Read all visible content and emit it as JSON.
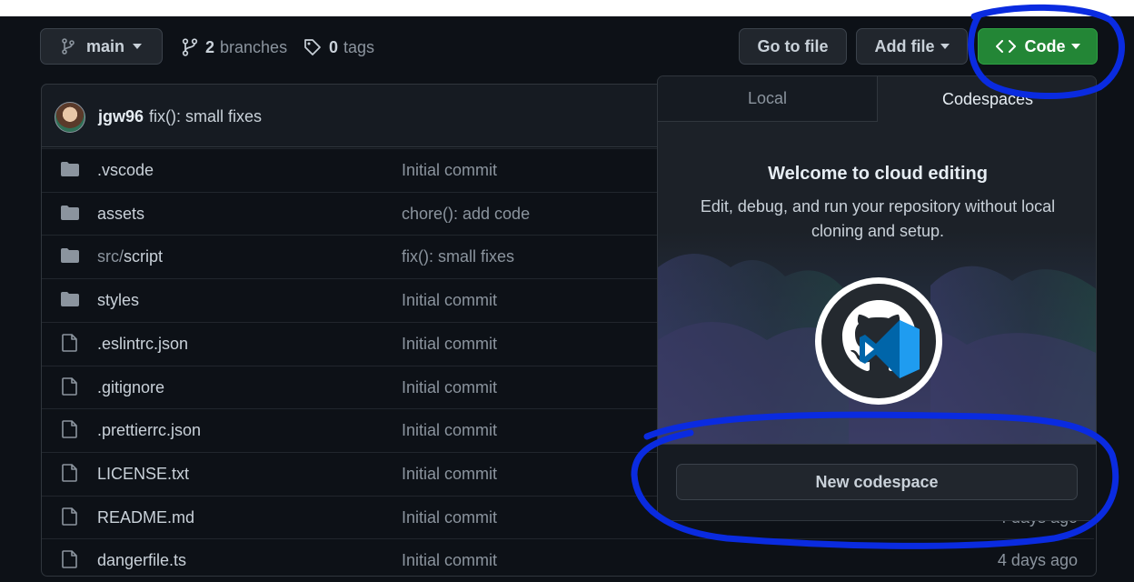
{
  "toolbar": {
    "branch_label": "main",
    "branches_count": "2",
    "branches_label": "branches",
    "tags_count": "0",
    "tags_label": "tags",
    "go_to_file": "Go to file",
    "add_file": "Add file",
    "code": "Code"
  },
  "commit": {
    "author": "jgw96",
    "message": "fix(): small fixes"
  },
  "files": [
    {
      "type": "folder",
      "prefix": "",
      "name": ".vscode",
      "message": "Initial commit",
      "age": ""
    },
    {
      "type": "folder",
      "prefix": "",
      "name": "assets",
      "message": "chore(): add code",
      "age": ""
    },
    {
      "type": "folder",
      "prefix": "src/",
      "name": "script",
      "message": "fix(): small fixes",
      "age": ""
    },
    {
      "type": "folder",
      "prefix": "",
      "name": "styles",
      "message": "Initial commit",
      "age": ""
    },
    {
      "type": "file",
      "prefix": "",
      "name": ".eslintrc.json",
      "message": "Initial commit",
      "age": ""
    },
    {
      "type": "file",
      "prefix": "",
      "name": ".gitignore",
      "message": "Initial commit",
      "age": ""
    },
    {
      "type": "file",
      "prefix": "",
      "name": ".prettierrc.json",
      "message": "Initial commit",
      "age": ""
    },
    {
      "type": "file",
      "prefix": "",
      "name": "LICENSE.txt",
      "message": "Initial commit",
      "age": ""
    },
    {
      "type": "file",
      "prefix": "",
      "name": "README.md",
      "message": "Initial commit",
      "age": "4 days ago"
    },
    {
      "type": "file",
      "prefix": "",
      "name": "dangerfile.ts",
      "message": "Initial commit",
      "age": "4 days ago"
    }
  ],
  "panel": {
    "tabs": [
      "Local",
      "Codespaces"
    ],
    "active_tab": "Codespaces",
    "title": "Welcome to cloud editing",
    "description": "Edit, debug, and run your repository without local cloning and setup.",
    "new_codespace": "New codespace"
  },
  "colors": {
    "background": "#0d1117",
    "code_button": "#238636",
    "annotation": "#0a2be0"
  },
  "icons": {
    "branch": "git-branch-icon",
    "branches": "git-branches-icon",
    "tag": "tag-icon",
    "code": "code-brackets-icon",
    "folder": "folder-icon",
    "file": "file-icon",
    "logo": "github-codespaces-logo"
  }
}
